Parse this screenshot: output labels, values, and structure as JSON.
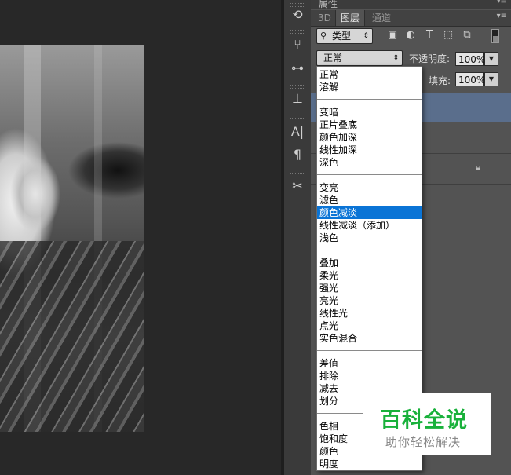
{
  "panel": {
    "title": "属性",
    "tabs": [
      "3D",
      "图层",
      "通道"
    ],
    "active_tab": "图层",
    "filter": {
      "kind_label": "类型"
    },
    "blend_mode": "正常",
    "opacity_label": "不透明度:",
    "opacity_value": "100%",
    "fill_label": "填充:",
    "fill_value": "100%"
  },
  "blend_menu": {
    "groups": [
      [
        "正常",
        "溶解"
      ],
      [
        "变暗",
        "正片叠底",
        "颜色加深",
        "线性加深",
        "深色"
      ],
      [
        "变亮",
        "滤色",
        "颜色减淡",
        "线性减淡（添加）",
        "浅色"
      ],
      [
        "叠加",
        "柔光",
        "强光",
        "亮光",
        "线性光",
        "点光",
        "实色混合"
      ],
      [
        "差值",
        "排除",
        "减去",
        "划分"
      ],
      [
        "色相",
        "饱和度",
        "颜色",
        "明度"
      ]
    ],
    "highlighted": "颜色减淡"
  },
  "toolstrip": {
    "icons": [
      "history-brush-icon",
      "brush-presets-icon",
      "adjust-icon",
      "clone-source-icon",
      "character-icon",
      "paragraph-icon",
      "tool-presets-icon"
    ],
    "glyphs": [
      "⟲",
      "⑂",
      "⊶",
      "⊥",
      "A|",
      "¶",
      "✂"
    ]
  },
  "watermark": {
    "title": "百科全说",
    "subtitle": "助你轻松解决"
  },
  "colors": {
    "highlight": "#0a74d6",
    "brand_green": "#19b13b",
    "selected_layer": "#5a6e8c"
  }
}
